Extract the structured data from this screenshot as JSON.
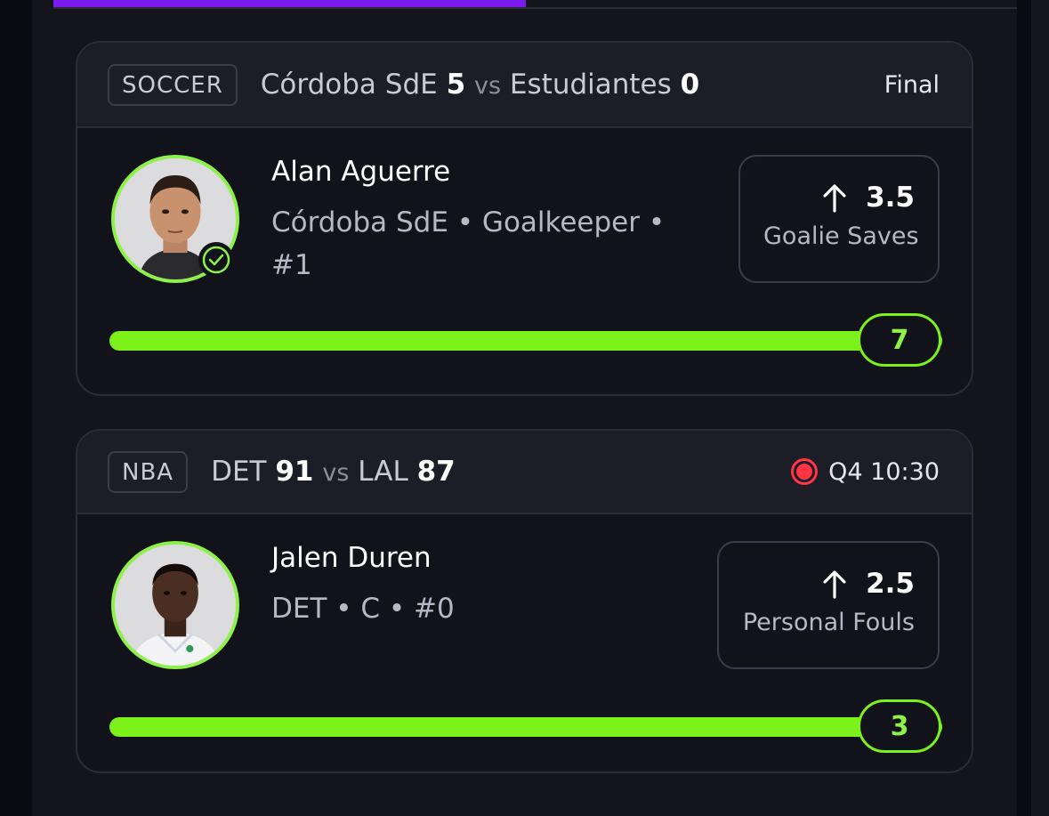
{
  "header_progress": {
    "fraction": 0.49,
    "color": "#7a1cf0"
  },
  "colors": {
    "accent_green": "#7cf21a",
    "live_red": "#ff3545",
    "card_bg": "#11121a",
    "header_bg": "#1c1d27"
  },
  "cards": [
    {
      "sport": "SOCCER",
      "team_a": "Córdoba SdE",
      "score_a": "5",
      "vs": "vs",
      "team_b": "Estudiantes",
      "score_b": "0",
      "status": "Final",
      "live": false,
      "player": {
        "name": "Alan Aguerre",
        "meta": "Córdoba SdE • Goalkeeper • #1",
        "avatar_icon": "player-photo",
        "verified_icon": "check-circle-icon"
      },
      "line": {
        "direction_icon": "arrow-up-icon",
        "value": "3.5",
        "stat": "Goalie Saves"
      },
      "progress": {
        "count": "7",
        "fraction": 1.0
      }
    },
    {
      "sport": "NBA",
      "team_a": "DET",
      "score_a": "91",
      "vs": "vs",
      "team_b": "LAL",
      "score_b": "87",
      "status": "Q4 10:30",
      "live": true,
      "player": {
        "name": "Jalen Duren",
        "meta": "DET • C • #0",
        "avatar_icon": "player-photo"
      },
      "line": {
        "direction_icon": "arrow-up-icon",
        "value": "2.5",
        "stat": "Personal Fouls"
      },
      "progress": {
        "count": "3",
        "fraction": 1.0
      }
    }
  ]
}
